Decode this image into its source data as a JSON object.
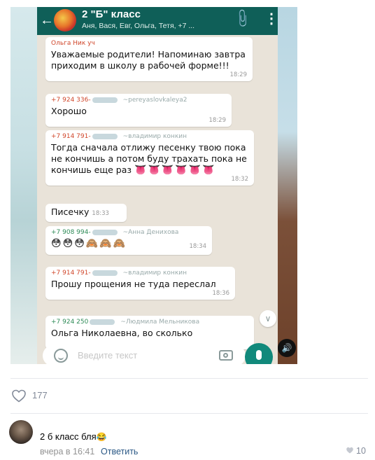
{
  "chat": {
    "title": "2 \"Б\" класс",
    "subtitle": "Аня, Вася, Евг, Ольга, Тетя, +7 ..."
  },
  "messages": [
    {
      "sender": "Ольга Ник уч",
      "alias": "",
      "body": "Уважаемые родители! Напоминаю завтра приходим в школу в рабочей форме!!!",
      "time": "18:29"
    },
    {
      "sender": "+7 924 336-",
      "alias": "~pereyaslovkaleya2",
      "body": "Хорошо",
      "time": "18:29"
    },
    {
      "sender": "+7 914 791-",
      "alias": "~владимир конкин",
      "body": "Тогда сначала отлижу песенку твою пока не кончишь а потом буду трахать пока не кончишь еще раз",
      "emoji": "👅👅👅👅👅👅",
      "time": "18:32"
    },
    {
      "sender": "",
      "alias": "",
      "body": "Писечку",
      "time": "18:33"
    },
    {
      "sender": "+7 908 994-",
      "alias": "~Анна Денихова",
      "emoji": "😳😳😳🙈🙈🙈",
      "time": "18:34"
    },
    {
      "sender": "+7 914 791-",
      "alias": "~владимир конкин",
      "body": "Прошу прощения не туда переслал",
      "time": "18:36"
    },
    {
      "sender": "+7 924 250",
      "alias": "~Людмила Мельникова",
      "body": "Ольга Николаевна, во сколько"
    }
  ],
  "input": {
    "placeholder": "Введите текст"
  },
  "post": {
    "likes": "177"
  },
  "comment": {
    "text": "2 б класс бля",
    "emoji": "😂",
    "time": "вчера в 16:41",
    "reply_label": "Ответить",
    "likes": "10"
  },
  "icons": {
    "back": "arrow-left-icon",
    "clip": "paperclip-icon",
    "menu": "more-vertical-icon",
    "scroll": "chevron-down-icon",
    "smile": "smile-icon",
    "camera": "camera-icon",
    "mic": "microphone-icon",
    "sound": "sound-icon",
    "heart": "heart-icon"
  },
  "colors": {
    "header": "#0f5f58",
    "vk_link": "#2a5885",
    "muted": "#828a99"
  }
}
